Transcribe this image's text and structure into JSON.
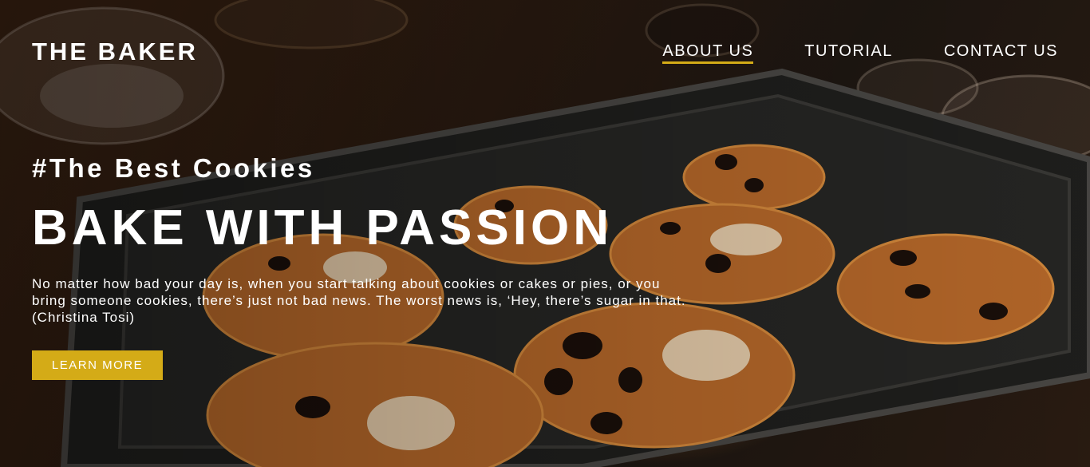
{
  "brand": {
    "name": "THE BAKER"
  },
  "nav": {
    "items": [
      {
        "label": "ABOUT US",
        "active": true
      },
      {
        "label": "TUTORIAL",
        "active": false
      },
      {
        "label": "CONTACT US",
        "active": false
      }
    ]
  },
  "hero": {
    "tagline": "#The Best Cookies",
    "headline": "BAKE WITH PASSION",
    "quote": "No matter how bad your day is, when you start talking about cookies or cakes or pies, or you bring someone cookies, there’s just not bad news. The worst news is, ‘Hey, there’s sugar in that. (Christina Tosi)",
    "cta_label": "LEARN MORE"
  },
  "colors": {
    "accent": "#d4ab17",
    "text": "#ffffff",
    "background": "#2a1a10"
  },
  "icons": {
    "background_image": "cookies-on-baking-tray-photo"
  }
}
